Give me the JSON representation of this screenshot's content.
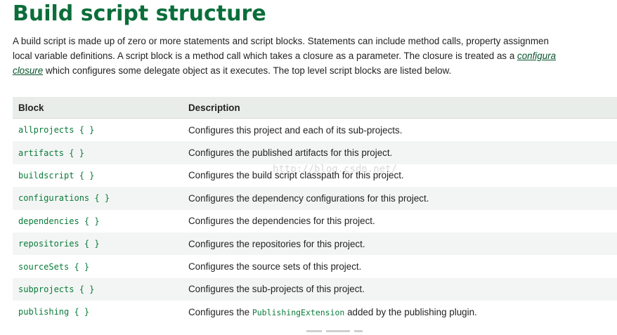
{
  "title": "Build script structure",
  "intro": {
    "line1": "A build script is made up of zero or more statements and script blocks. Statements can include method calls, property assignmen",
    "line2_before": "local variable definitions. A script block is a method call which takes a closure as a parameter. The closure is treated as a ",
    "line2_link": "configura",
    "line3_link": "closure",
    "line3_after": " which configures some delegate object as it executes. The top level script blocks are listed below."
  },
  "table": {
    "headers": {
      "block": "Block",
      "description": "Description"
    },
    "rows": [
      {
        "block": "allprojects { }",
        "description": "Configures this project and each of its sub-projects."
      },
      {
        "block": "artifacts { }",
        "description": "Configures the published artifacts for this project."
      },
      {
        "block": "buildscript { }",
        "description": "Configures the build script classpath for this project."
      },
      {
        "block": "configurations { }",
        "description": "Configures the dependency configurations for this project."
      },
      {
        "block": "dependencies { }",
        "description": "Configures the dependencies for this project."
      },
      {
        "block": "repositories { }",
        "description": "Configures the repositories for this project."
      },
      {
        "block": "sourceSets { }",
        "description": "Configures the source sets of this project."
      },
      {
        "block": "subprojects { }",
        "description": "Configures the sub-projects of this project."
      },
      {
        "block": "publishing { }",
        "description_before": "Configures the ",
        "description_code": "PublishingExtension",
        "description_after": " added by the publishing plugin."
      }
    ]
  },
  "watermark": "http://blog.csdn.net/",
  "colors": {
    "title": "#0b6e3a",
    "code": "#0a7a3a",
    "header_bg": "#e9edea",
    "stripe_bg": "#f3f5f4"
  }
}
